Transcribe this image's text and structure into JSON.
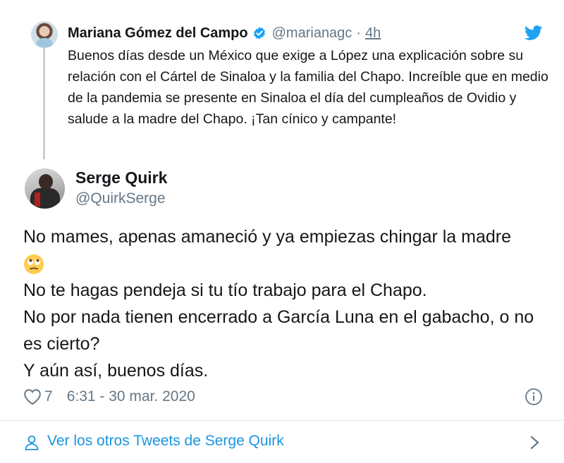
{
  "parent_tweet": {
    "author_name": "Mariana Gómez del Campo",
    "handle": "@marianagc",
    "separator": "·",
    "time": "4h",
    "text": "Buenos días desde un México que exige a López una explicación sobre su relación con el Cártel de Sinaloa y la familia del Chapo. Increíble que en medio de la pandemia se presente en Sinaloa el día del cumpleaños de Ovidio y salude a la madre del Chapo. ¡Tan cínico y campante!"
  },
  "tweet": {
    "author_name": "Serge Quirk",
    "handle": "@QuirkSerge",
    "lines": {
      "l1": "No mames, apenas amaneció y ya empiezas chingar la madre",
      "l3": "No te hagas pendeja si tu tío trabajo para el Chapo.",
      "l4": "No por nada tienen encerrado a García Luna en el gabacho, o no es cierto?",
      "l5": "Y aún así, buenos días."
    },
    "emoji_icon": "face-with-rolling-eyes",
    "likes": "7",
    "timestamp": "6:31 - 30 mar. 2020"
  },
  "footer": {
    "link_text": "Ver los otros Tweets de Serge Quirk"
  },
  "colors": {
    "text": "#14171a",
    "secondary": "#657786",
    "link": "#1b95e0",
    "verified": "#1da1f2",
    "twitter_blue": "#1da1f2",
    "divider": "#e1e8ed"
  },
  "icons": [
    "verified-badge-icon",
    "twitter-bird-icon",
    "heart-icon",
    "info-icon",
    "user-icon",
    "chevron-right-icon"
  ]
}
